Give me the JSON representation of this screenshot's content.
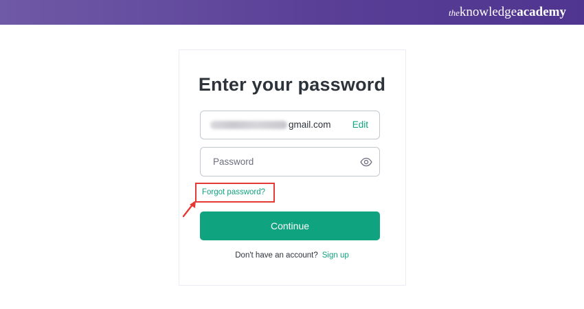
{
  "brand": {
    "the": "the",
    "knowledge": "knowledge",
    "academy": "academy"
  },
  "login": {
    "title": "Enter your password",
    "email_visible_suffix": "gmail.com",
    "edit_label": "Edit",
    "password_placeholder": "Password",
    "forgot_label": "Forgot password?",
    "continue_label": "Continue",
    "signup_prompt": "Don't have an account?",
    "signup_label": "Sign up"
  },
  "colors": {
    "accent": "#10a37f",
    "highlight": "#e53935",
    "header": "#5a3f97"
  },
  "icons": {
    "password_toggle": "eye-icon",
    "pointer": "arrow-annotation-icon"
  }
}
